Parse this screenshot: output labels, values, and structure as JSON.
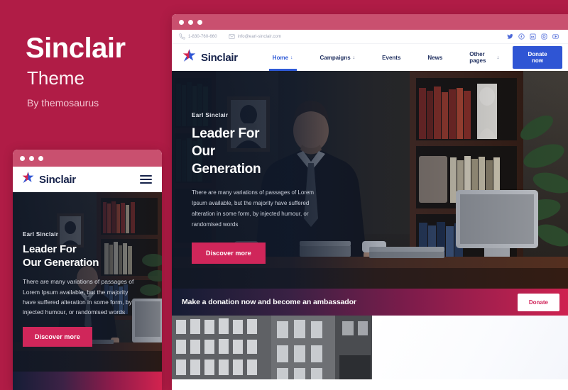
{
  "promo": {
    "title": "Sinclair",
    "subtitle": "Theme",
    "author": "By themosaurus"
  },
  "colors": {
    "background": "#b01c46",
    "titlebar": "#c9506f",
    "accent_blue": "#2f55d4",
    "accent_crimson": "#d0265a",
    "navy": "#16224a"
  },
  "desktop": {
    "topbar": {
      "phone": "1-830-760-660",
      "email": "info@earl-sinclair.com",
      "phone_icon": "phone-icon",
      "email_icon": "envelope-icon",
      "social": [
        {
          "name": "twitter-icon",
          "label": "Twitter"
        },
        {
          "name": "facebook-icon",
          "label": "Facebook"
        },
        {
          "name": "linkedin-icon",
          "label": "LinkedIn"
        },
        {
          "name": "instagram-icon",
          "label": "Instagram"
        },
        {
          "name": "youtube-icon",
          "label": "YouTube"
        }
      ]
    },
    "nav": {
      "brand": "Sinclair",
      "items": [
        {
          "label": "Home",
          "has_caret": true,
          "active": true
        },
        {
          "label": "Campaigns",
          "has_caret": true,
          "active": false
        },
        {
          "label": "Events",
          "has_caret": false,
          "active": false
        },
        {
          "label": "News",
          "has_caret": false,
          "active": false
        },
        {
          "label": "Other pages",
          "has_caret": true,
          "active": false
        }
      ],
      "cta": "Donate now"
    },
    "hero": {
      "eyebrow": "Earl Sinclair",
      "heading_line1": "Leader For",
      "heading_line2": "Our",
      "heading_line3": "Generation",
      "paragraph": "There are many variations of passages of Lorem Ipsum available, but the majority have suffered alteration in some form, by injected humour, or randomised words",
      "button": "Discover more"
    },
    "banner": {
      "text": "Make a donation now and become an ambassador",
      "button": "Donate"
    }
  },
  "mobile": {
    "brand": "Sinclair",
    "menu_icon": "hamburger-menu-icon",
    "hero": {
      "eyebrow": "Earl Sinclair",
      "heading_line1": "Leader For",
      "heading_line2": "Our Generation",
      "paragraph": "There are many variations of passages of Lorem Ipsum available, but the majority have suffered alteration in some form, by injected humour, or randomised words",
      "button": "Discover more"
    }
  }
}
